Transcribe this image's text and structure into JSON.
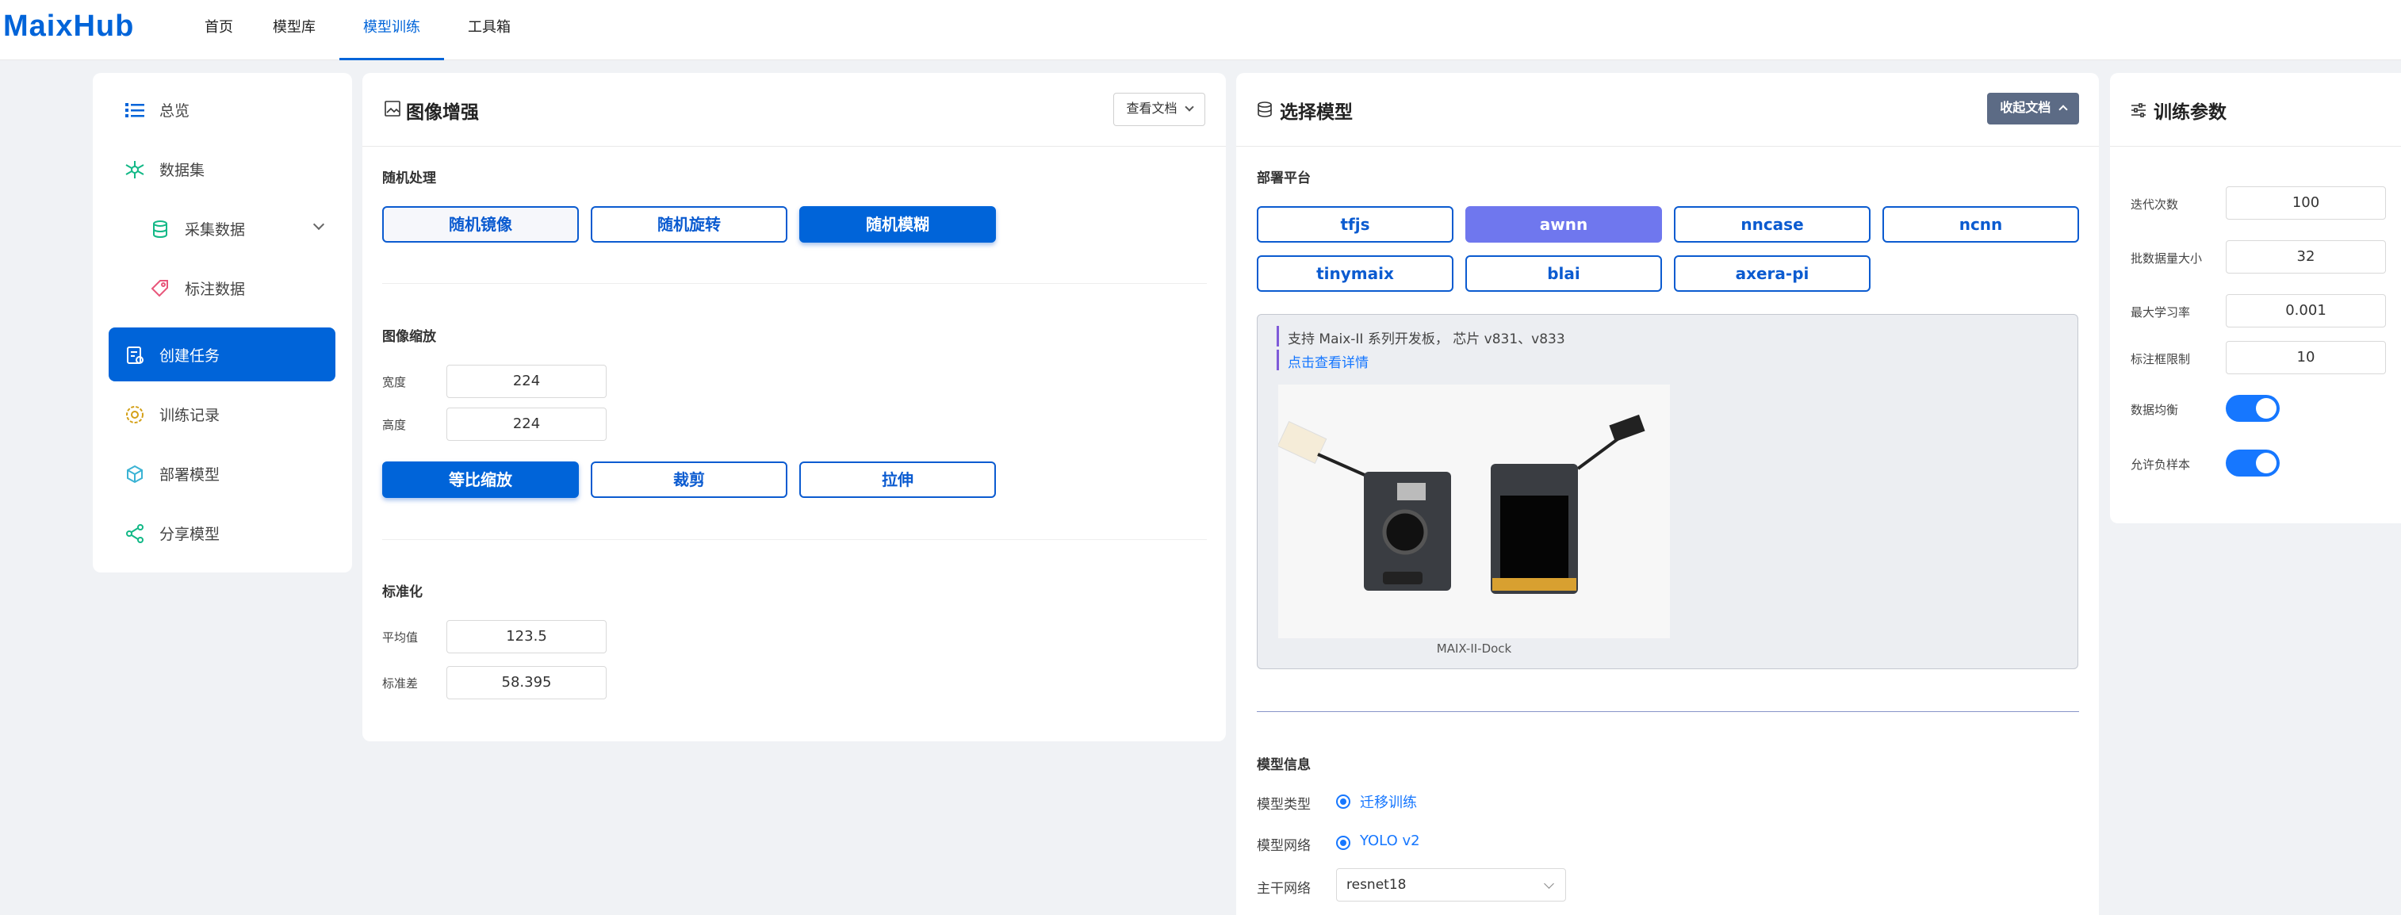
{
  "brand": "MaixHub",
  "nav": [
    {
      "label": "首页"
    },
    {
      "label": "模型库"
    },
    {
      "label": "模型训练"
    },
    {
      "label": "工具箱"
    }
  ],
  "sidebar": {
    "items": [
      {
        "label": "总览"
      },
      {
        "label": "数据集"
      },
      {
        "label": "采集数据"
      },
      {
        "label": "标注数据"
      },
      {
        "label": "创建任务"
      },
      {
        "label": "训练记录"
      },
      {
        "label": "部署模型"
      },
      {
        "label": "分享模型"
      }
    ]
  },
  "augment": {
    "title": "图像增强",
    "doc_button": "查看文档",
    "random": {
      "label": "随机处理",
      "options": [
        "随机镜像",
        "随机旋转",
        "随机模糊"
      ],
      "selected": "随机模糊"
    },
    "scale": {
      "label": "图像缩放",
      "width_label": "宽度",
      "width": "224",
      "height_label": "高度",
      "height": "224",
      "modes": [
        "等比缩放",
        "裁剪",
        "拉伸"
      ],
      "selected": "等比缩放"
    },
    "normalize": {
      "label": "标准化",
      "mean_label": "平均值",
      "mean": "123.5",
      "std_label": "标准差",
      "std": "58.395"
    }
  },
  "model": {
    "title": "选择模型",
    "collapse_button": "收起文档",
    "platform_label": "部署平台",
    "platforms": [
      "tfjs",
      "awnn",
      "nncase",
      "ncnn",
      "tinymaix",
      "blai",
      "axera-pi"
    ],
    "selected_platform": "awnn",
    "support_text": "支持 Maix-II 系列开发板， 芯片 v831、v833",
    "detail_link": "点击查看详情",
    "board_caption": "MAIX-II-Dock",
    "info_label": "模型信息",
    "type_label": "模型类型",
    "type_value": "迁移训练",
    "network_label": "模型网络",
    "network_value": "YOLO v2",
    "backbone_label": "主干网络",
    "backbone_value": "resnet18"
  },
  "params": {
    "title": "训练参数",
    "fields": [
      {
        "label": "迭代次数",
        "value": "100"
      },
      {
        "label": "批数据量大小",
        "value": "32"
      },
      {
        "label": "最大学习率",
        "value": "0.001"
      },
      {
        "label": "标注框限制",
        "value": "10"
      }
    ],
    "balance_label": "数据均衡",
    "balance_on": true,
    "negative_label": "允许负样本",
    "negative_on": true
  },
  "colors": {
    "accent": "#0064d9",
    "platform_selected": "#6f77ee",
    "toggle": "#1677ff"
  }
}
